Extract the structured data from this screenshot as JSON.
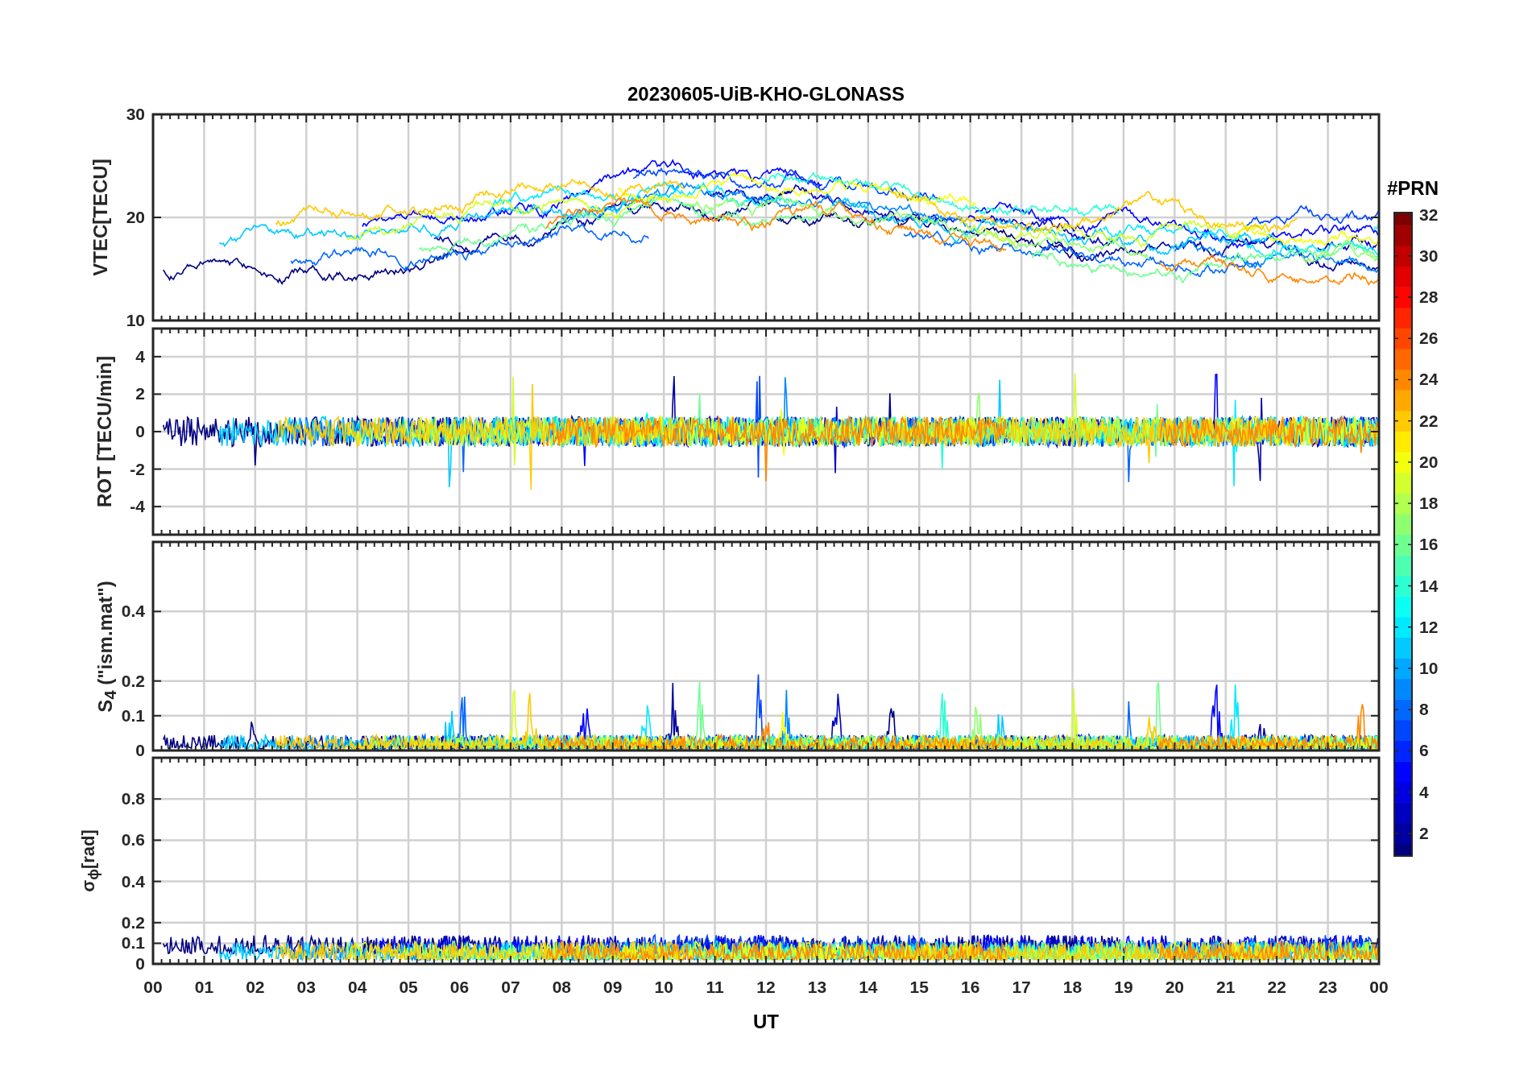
{
  "title": "20230605-UiB-KHO-GLONASS",
  "panels": [
    {
      "ylabel": "VTEC[TECU]",
      "yticks": [
        "30",
        "20",
        "10"
      ]
    },
    {
      "ylabel": "ROT [TECU/min]",
      "yticks": [
        "4",
        "2",
        "0",
        "-2",
        "-4"
      ]
    },
    {
      "ylabel": "S$_{4}$ (\"ism.mat\")",
      "yticks": [
        "0.4",
        "0.2",
        "0.1",
        "0"
      ]
    },
    {
      "ylabel": "σ$_{ϕ}$[rad]",
      "yticks": [
        "0.8",
        "0.6",
        "0.4",
        "0.2",
        "0.1",
        "0"
      ]
    }
  ],
  "xticks": [
    "00",
    "01",
    "02",
    "03",
    "04",
    "05",
    "06",
    "07",
    "08",
    "09",
    "10",
    "11",
    "12",
    "13",
    "14",
    "15",
    "16",
    "17",
    "18",
    "19",
    "20",
    "21",
    "22",
    "23",
    "00"
  ],
  "xlabel": "UT",
  "colorbar": {
    "title": "#PRN",
    "ticks": [
      "32",
      "30",
      "28",
      "26",
      "24",
      "22",
      "20",
      "18",
      "16",
      "14",
      "12",
      "10",
      "8",
      "6",
      "4",
      "2"
    ]
  }
}
